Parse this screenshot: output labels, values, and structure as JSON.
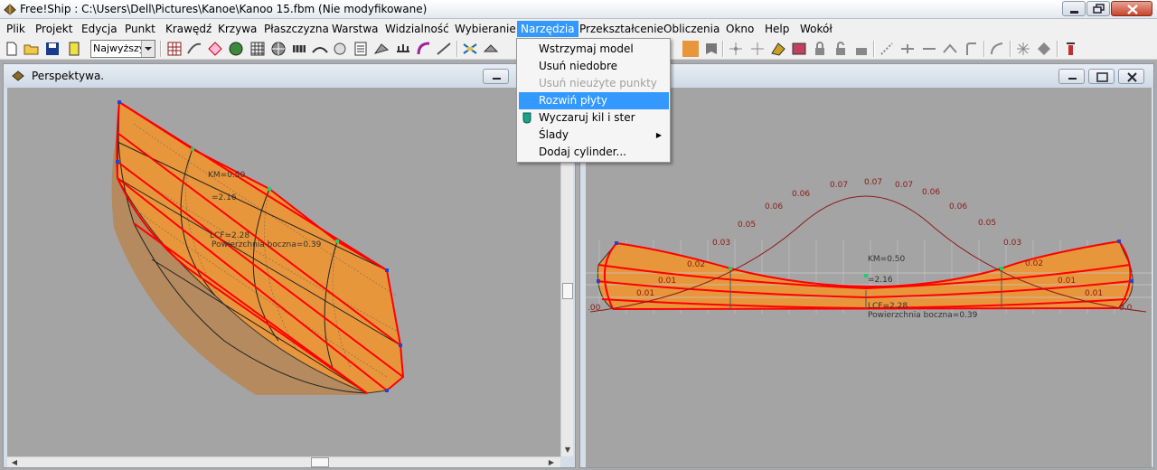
{
  "window": {
    "title": "Free!Ship  : C:\\Users\\Dell\\Pictures\\Kanoe\\Kanoo 15.fbm (Nie modyfikowane)"
  },
  "menubar": {
    "items": [
      "Plik",
      "Projekt",
      "Edycja",
      "Punkt",
      "Krawędź",
      "Krzywa",
      "Płaszczyzna",
      "Warstwa",
      "Widzialność",
      "Wybieranie",
      "Narzędzia",
      "Przekształcenie",
      "Obliczenia",
      "Okno",
      "Help",
      "Wokół"
    ],
    "active": "Narzędzia"
  },
  "toolbar": {
    "precision_select": "Najwyższy"
  },
  "narzedzia_menu": {
    "items": [
      {
        "label": "Wstrzymaj model",
        "state": "normal"
      },
      {
        "label": "Usuń niedobre",
        "state": "normal"
      },
      {
        "label": "Usuń nieużyte punkty",
        "state": "disabled"
      },
      {
        "label": "Rozwiń płyty",
        "state": "highlighted"
      },
      {
        "label": "Wyczaruj kil i ster",
        "state": "normal",
        "icon": "keel-rudder-icon"
      },
      {
        "label": "Ślady",
        "state": "normal",
        "submenu": true
      },
      {
        "label": "Dodaj cylinder...",
        "state": "normal"
      }
    ]
  },
  "left_view": {
    "title": "Perspektywa.",
    "labels": {
      "km": "KM=0.50",
      "km2": "=2.16",
      "lcf": "LCF=2.28",
      "lateral_area": "Powierzchnia boczna=0.39"
    }
  },
  "right_view": {
    "labels": {
      "km": "KM=0.50",
      "km2": "=2.16",
      "lcf": "LCF=2.28",
      "lateral_area": "Powierzchnia boczna=0.39",
      "curve_values": [
        "0.07",
        "0.07",
        "0.07",
        "0.06",
        "0.06",
        "0.06",
        "0.06",
        "0.05",
        "0.05",
        "0.03",
        "0.03",
        "0.02",
        "0.02",
        "0.01",
        "0.01",
        "0.01",
        "0.01",
        ".00",
        "0.0"
      ]
    }
  },
  "colors": {
    "hull_fill": "#e8963c",
    "hull_edge": "#ff0000",
    "curve": "#8b1a1a",
    "menu_highlight": "#3399ff"
  }
}
